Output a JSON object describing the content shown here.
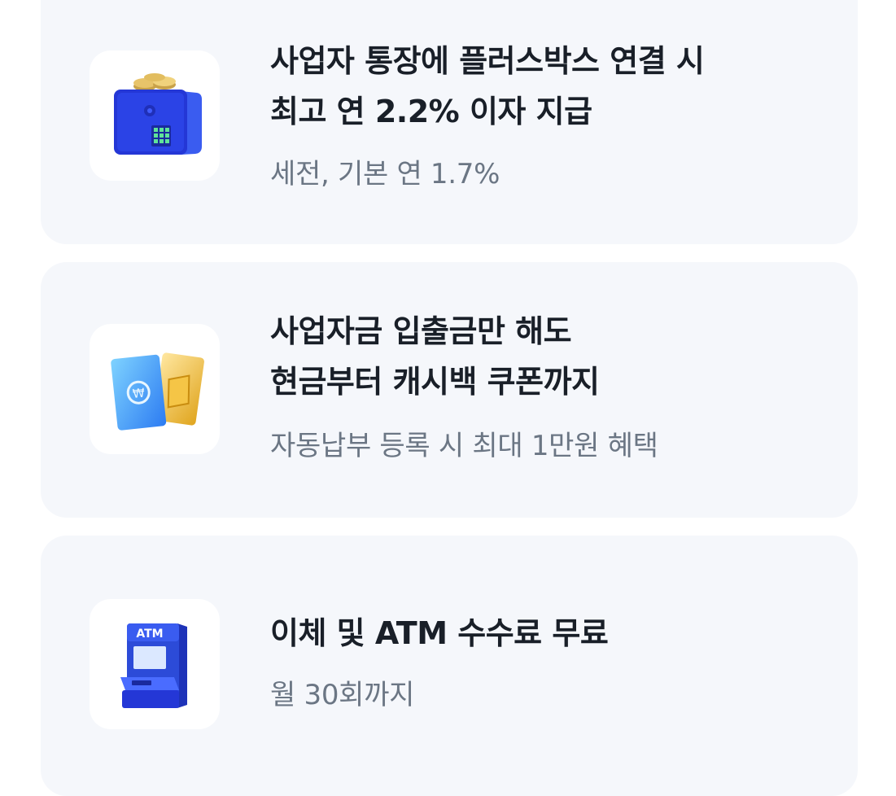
{
  "benefits": [
    {
      "icon": "safe-with-coins-icon",
      "title_line1": "사업자 통장에 플러스박스 연결 시",
      "title_line2": "최고 연 2.2% 이자 지급",
      "subtitle": "세전, 기본 연 1.7%"
    },
    {
      "icon": "cashback-cards-icon",
      "title_line1": "사업자금 입출금만 해도",
      "title_line2": "현금부터 캐시백 쿠폰까지",
      "subtitle": "자동납부 등록 시 최대 1만원 혜택"
    },
    {
      "icon": "atm-machine-icon",
      "icon_label": "ATM",
      "title_line1": "이체 및 ATM 수수료 무료",
      "subtitle": "월 30회까지"
    }
  ],
  "colors": {
    "card_background": "#f5f7fb",
    "title_text": "#191f28",
    "subtitle_text": "#6b7684",
    "accent_blue": "#2c4bd8"
  }
}
